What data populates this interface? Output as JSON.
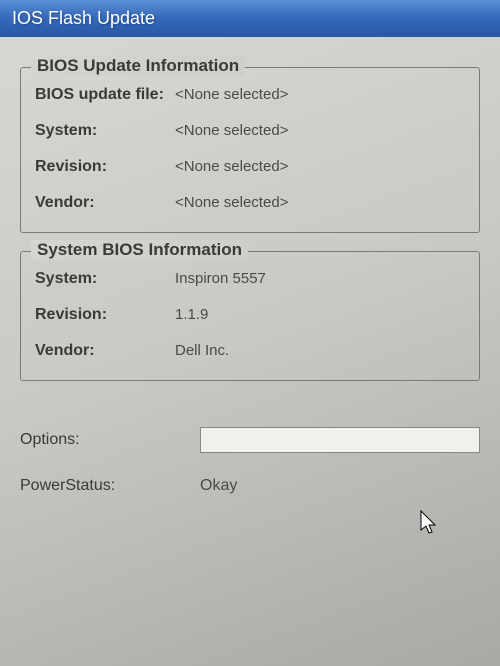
{
  "window": {
    "title": "IOS Flash Update"
  },
  "update_info": {
    "legend": "BIOS Update Information",
    "file_label": "BIOS update file:",
    "file_value": "<None selected>",
    "system_label": "System:",
    "system_value": "<None selected>",
    "revision_label": "Revision:",
    "revision_value": "<None selected>",
    "vendor_label": "Vendor:",
    "vendor_value": "<None selected>"
  },
  "system_info": {
    "legend": "System BIOS Information",
    "system_label": "System:",
    "system_value": "Inspiron 5557",
    "revision_label": "Revision:",
    "revision_value": "1.1.9",
    "vendor_label": "Vendor:",
    "vendor_value": "Dell Inc."
  },
  "footer": {
    "options_label": "Options:",
    "options_value": "",
    "power_status_label": "PowerStatus:",
    "power_status_value": "Okay"
  }
}
